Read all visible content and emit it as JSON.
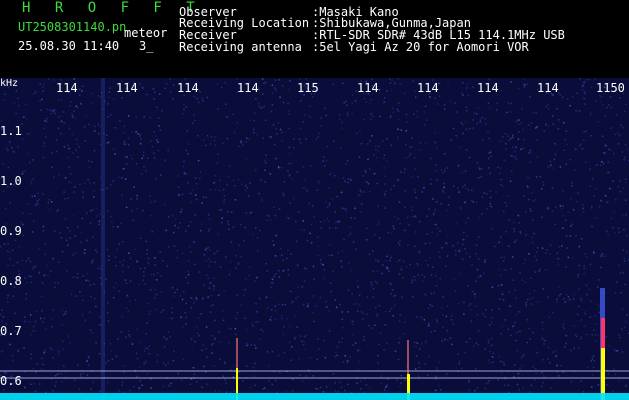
{
  "header": {
    "app_title": "H R O F F T",
    "file_name": "UT2508301140.pn",
    "meteor_label": "meteor",
    "timestamp": "25.08.30 11:40",
    "count": "3_",
    "info": [
      {
        "label": "Observer",
        "value": ":Masaki Kano"
      },
      {
        "label": "Receiving Location",
        "value": ":Shibukawa,Gunma,Japan"
      },
      {
        "label": "Receiver",
        "value": ":RTL-SDR SDR# 43dB L15 114.1MHz USB"
      },
      {
        "label": "Receiving antenna",
        "value": ":5el Yagi Az 20 for Aomori VOR"
      }
    ]
  },
  "spectrogram": {
    "unit": "kHz",
    "x_ticks": [
      "114",
      "114",
      "114",
      "114",
      "115",
      "114",
      "114",
      "114",
      "114",
      "1150"
    ],
    "y_ticks": [
      "1.1",
      "1.0",
      "0.9",
      "0.8",
      "0.7",
      "0.6"
    ],
    "colors": {
      "background": "#0a0c3a",
      "noise": "#2a3a9a",
      "echo": "#ffff00",
      "baseline": "#00e5ff"
    }
  }
}
